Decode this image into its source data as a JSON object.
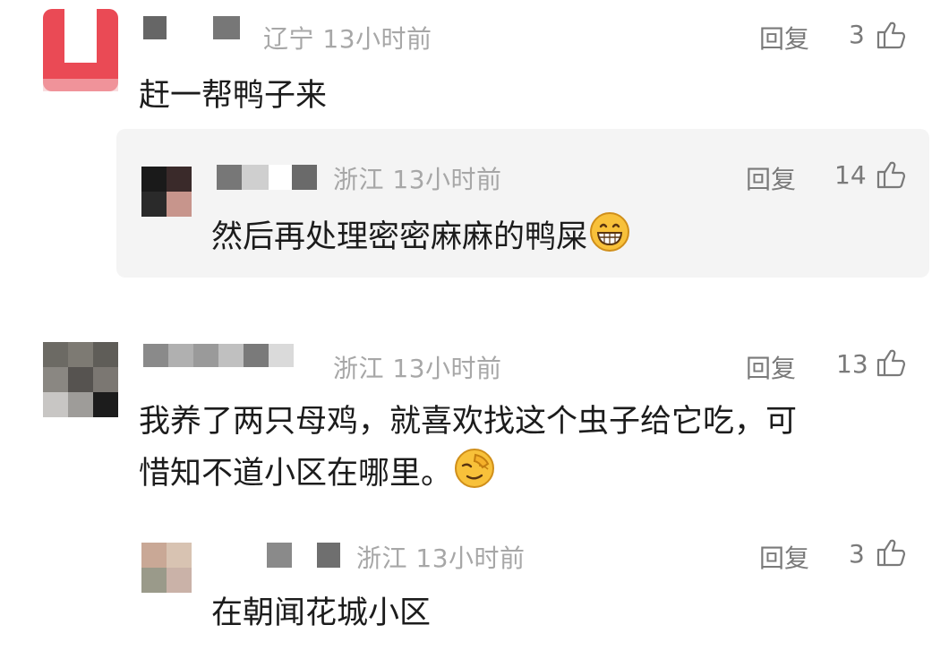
{
  "comments": [
    {
      "location": "辽宁",
      "time": "13小时前",
      "reply_label": "回复",
      "likes": "3",
      "text": "赶一帮鸭子来",
      "reply": {
        "location": "浙江",
        "time": "13小时前",
        "reply_label": "回复",
        "likes": "14",
        "text": "然后再处理密密麻麻的鸭屎",
        "emoji": "grinning-face-emoji"
      }
    },
    {
      "location": "浙江",
      "time": "13小时前",
      "reply_label": "回复",
      "likes": "13",
      "text_line1": "我养了两只母鸡，就喜欢找这个虫子给它吃，可",
      "text_line2": "惜知不道小区在哪里。",
      "emoji": "facepalm-emoji",
      "reply": {
        "location": "浙江",
        "time": "13小时前",
        "reply_label": "回复",
        "likes": "3",
        "text": "在朝闻花城小区"
      }
    }
  ],
  "colors": {
    "background": "#ffffff",
    "reply_background": "#f4f4f4",
    "meta_text": "#a7a7a7",
    "action_text": "#7a7a7a",
    "body_text": "#1c1c1c",
    "avatar1_accent": "#e8434f"
  }
}
